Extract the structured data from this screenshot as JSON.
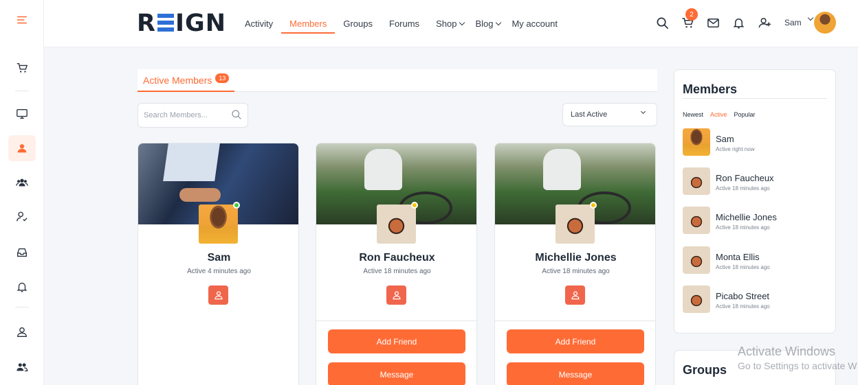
{
  "brand": {
    "logo": "REIGN",
    "accent": "#ff6b35"
  },
  "nav": [
    {
      "label": "Activity",
      "active": false,
      "has_menu": false
    },
    {
      "label": "Members",
      "active": true,
      "has_menu": false
    },
    {
      "label": "Groups",
      "active": false,
      "has_menu": false
    },
    {
      "label": "Forums",
      "active": false,
      "has_menu": false
    },
    {
      "label": "Shop",
      "active": false,
      "has_menu": true
    },
    {
      "label": "Blog",
      "active": false,
      "has_menu": true
    },
    {
      "label": "My account",
      "active": false,
      "has_menu": false
    }
  ],
  "header": {
    "cart_count": "2",
    "user_name": "Sam"
  },
  "sidebar": {
    "icons": [
      "menu-icon",
      "cart-icon",
      "monitor-icon",
      "members-icon",
      "groups-icon",
      "user-check-icon",
      "inbox-icon",
      "bell-icon",
      "profile-icon",
      "friends-icon"
    ]
  },
  "tabs": {
    "label": "Active Members",
    "count": "13"
  },
  "search": {
    "placeholder": "Search Members..."
  },
  "sort": {
    "selected": "Last Active"
  },
  "members": [
    {
      "name": "Sam",
      "activity": "Active 4 minutes ago",
      "status": "online",
      "friend_label": "",
      "message_label": ""
    },
    {
      "name": "Ron Faucheux",
      "activity": "Active 18 minutes ago",
      "status": "away",
      "friend_label": "Add Friend",
      "message_label": "Message"
    },
    {
      "name": "Michellie Jones",
      "activity": "Active 18 minutes ago",
      "status": "away",
      "friend_label": "Add Friend",
      "message_label": "Message"
    }
  ],
  "widget": {
    "title": "Members",
    "tabs": [
      "Newest",
      "Active",
      "Popular"
    ],
    "active_tab": "Active",
    "items": [
      {
        "name": "Sam",
        "activity": "Active right now"
      },
      {
        "name": "Ron Faucheux",
        "activity": "Active 18 minutes ago"
      },
      {
        "name": "Michellie Jones",
        "activity": "Active 18 minutes ago"
      },
      {
        "name": "Monta Ellis",
        "activity": "Active 18 minutes ago"
      },
      {
        "name": "Picabo Street",
        "activity": "Active 18 minutes ago"
      }
    ]
  },
  "widget2": {
    "title": "Groups"
  },
  "watermark": {
    "line1": "Activate Windows",
    "line2": "Go to Settings to activate W"
  }
}
